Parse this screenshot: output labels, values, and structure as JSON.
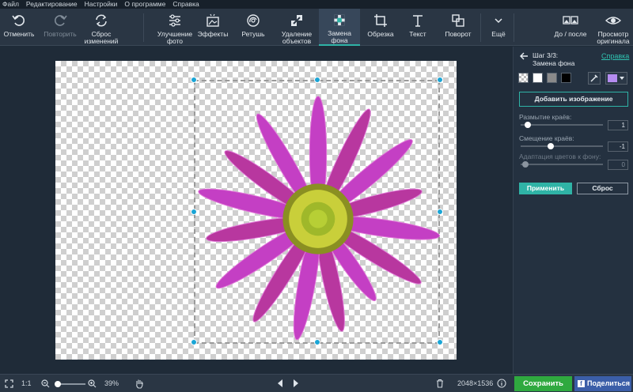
{
  "menu": [
    "Файл",
    "Редактирование",
    "Настройки",
    "О программе",
    "Справка"
  ],
  "toolbar": {
    "undo": "Отменить",
    "redo": "Повторить",
    "reset_changes": "Сброс\nизменений",
    "enhance": "Улучшение\nфото",
    "effects": "Эффекты",
    "retouch": "Ретушь",
    "remove_objects": "Удаление\nобъектов",
    "replace_bg": "Замена\nфона",
    "crop": "Обрезка",
    "text": "Текст",
    "rotate": "Поворот",
    "more": "Ещё",
    "before_after": "До / после",
    "view_original": "Просмотр\nоригинала"
  },
  "panel": {
    "step_title": "Шаг 3/3:\nЗамена фона",
    "help": "Справка",
    "swatch_colors": [
      "#ffffff",
      "#8a8a8a",
      "#000000"
    ],
    "selected_color": "#b58cf0",
    "add_image": "Добавить изображение",
    "sliders": [
      {
        "label": "Размытие краёв:",
        "value": "1",
        "position": 0.05,
        "enabled": true
      },
      {
        "label": "Смещение краёв:",
        "value": "-1",
        "position": 0.35,
        "enabled": true
      },
      {
        "label": "Адаптация цветов к фону:",
        "value": "0",
        "position": 0.02,
        "enabled": false
      }
    ],
    "apply": "Применить",
    "reset": "Сброс"
  },
  "status": {
    "ratio": "1:1",
    "zoom_percent": "39%",
    "zoom_level": 0.0,
    "dimensions": "2048×1536",
    "save": "Сохранить",
    "share": "Поделиться",
    "facebook_letter": "f"
  },
  "colors": {
    "accent": "#2fb3a6",
    "save_green": "#2fa93f",
    "share_blue": "#3b5ea8",
    "handle": "#1aa5d6",
    "petal": "#c43fc4",
    "flower_center": "#b8c232"
  }
}
